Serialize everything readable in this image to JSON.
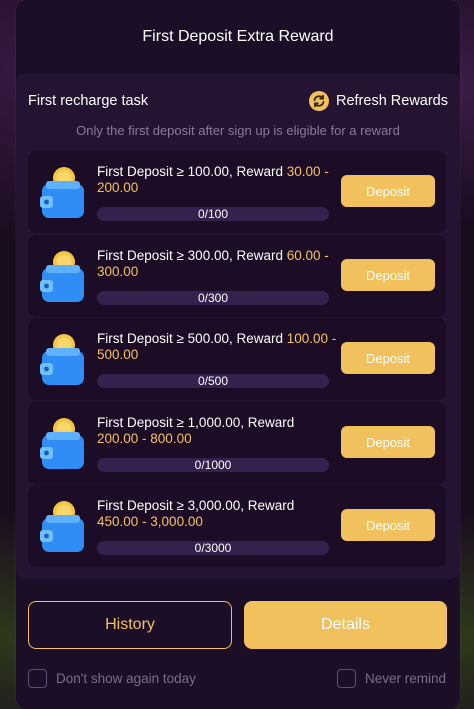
{
  "modal": {
    "title": "First Deposit Extra Reward"
  },
  "panel": {
    "task_title": "First recharge task",
    "refresh_label": "Refresh Rewards",
    "note": "Only the first deposit after sign up is eligible for a reward"
  },
  "tasks": [
    {
      "label": "First Deposit ≥ 100.00, Reward ",
      "reward": "30.00 - 200.00",
      "progress": "0/100",
      "progress_fraction": 0,
      "button": "Deposit"
    },
    {
      "label": "First Deposit ≥ 300.00, Reward ",
      "reward": "60.00 - 300.00",
      "progress": "0/300",
      "progress_fraction": 0,
      "button": "Deposit"
    },
    {
      "label": "First Deposit ≥ 500.00, Reward ",
      "reward": "100.00 - 500.00",
      "progress": "0/500",
      "progress_fraction": 0,
      "button": "Deposit"
    },
    {
      "label": "First Deposit ≥ 1,000.00, Reward ",
      "reward": "200.00 - 800.00",
      "progress": "0/1000",
      "progress_fraction": 0,
      "button": "Deposit"
    },
    {
      "label": "First Deposit ≥ 3,000.00, Reward ",
      "reward": "450.00 - 3,000.00",
      "progress": "0/3000",
      "progress_fraction": 0,
      "button": "Deposit"
    }
  ],
  "footer": {
    "history_label": "History",
    "details_label": "Details",
    "dont_show_label": "Don't show again today",
    "never_remind_label": "Never remind"
  },
  "colors": {
    "accent": "#f0c15c",
    "reward_text": "#f5c35b",
    "panel_bg": "#241432",
    "card_bg": "#1c0c26"
  },
  "icons": {
    "refresh": "refresh-icon",
    "wallet": "wallet-coin-icon"
  }
}
